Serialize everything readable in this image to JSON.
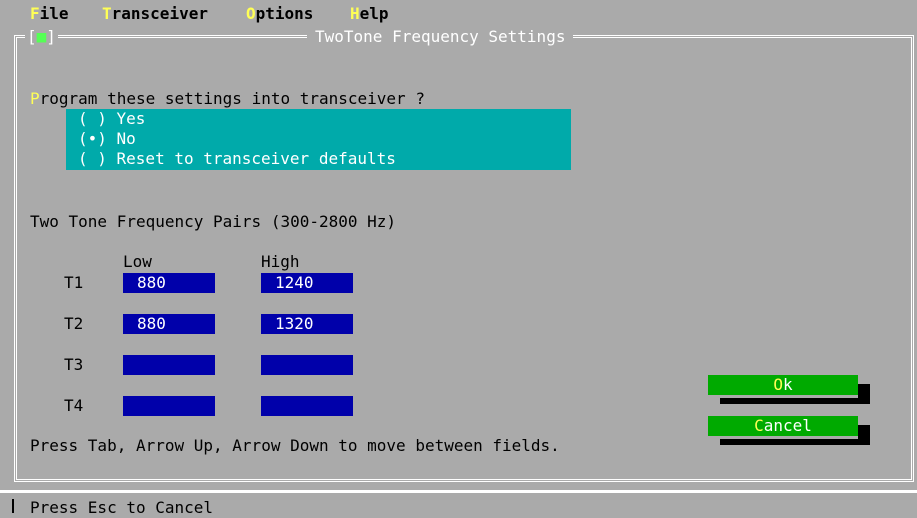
{
  "menu": {
    "file": {
      "hot": "F",
      "rest": "ile"
    },
    "transceiver": {
      "hot": "T",
      "rest": "ransceiver"
    },
    "options": {
      "hot": "O",
      "rest": "ptions"
    },
    "help": {
      "hot": "H",
      "rest": "elp"
    }
  },
  "dialog": {
    "close_open": "[",
    "close_dot": "■",
    "close_close": "]",
    "title": "TwoTone Frequency Settings"
  },
  "program": {
    "hot": "P",
    "rest": "rogram these settings into transceiver ?",
    "options": [
      "( ) Yes",
      "(•) No",
      "( ) Reset to transceiver defaults"
    ]
  },
  "pairs": {
    "heading": "Two Tone Frequency Pairs (300-2800 Hz)",
    "low_header": "Low",
    "high_header": "High",
    "rows": [
      {
        "label": "T1",
        "low": "880",
        "high": "1240"
      },
      {
        "label": "T2",
        "low": "880",
        "high": "1320"
      },
      {
        "label": "T3",
        "low": "",
        "high": ""
      },
      {
        "label": "T4",
        "low": "",
        "high": ""
      }
    ]
  },
  "hint": "Press Tab, Arrow Up, Arrow Down to move between fields.",
  "buttons": {
    "ok": {
      "hot": "O",
      "rest": "k"
    },
    "cancel": {
      "hot": "C",
      "rest": "ancel"
    }
  },
  "status": "Press Esc to Cancel",
  "colors": {
    "background": "#aaaaaa",
    "field_bg": "#0000aa",
    "radio_bg": "#00aaaa",
    "button_bg": "#00aa00",
    "hotkey": "#ffff55"
  }
}
